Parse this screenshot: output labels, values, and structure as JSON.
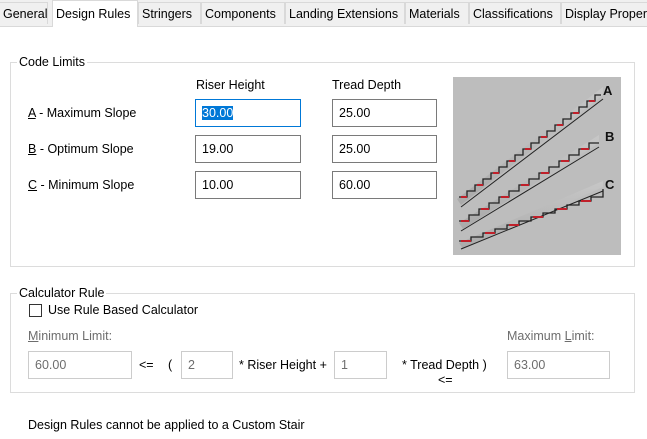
{
  "tabs": [
    {
      "label": "General",
      "active": false
    },
    {
      "label": "Design Rules",
      "active": true
    },
    {
      "label": "Stringers",
      "active": false
    },
    {
      "label": "Components",
      "active": false
    },
    {
      "label": "Landing Extensions",
      "active": false
    },
    {
      "label": "Materials",
      "active": false
    },
    {
      "label": "Classifications",
      "active": false
    },
    {
      "label": "Display Proper",
      "active": false
    }
  ],
  "code_limits": {
    "legend": "Code Limits",
    "col_riser": "Riser Height",
    "col_tread": "Tread Depth",
    "rows": [
      {
        "key": "A",
        "rest": " - Maximum Slope",
        "riser": "30.00",
        "tread": "25.00"
      },
      {
        "key": "B",
        "rest": " - Optimum Slope",
        "riser": "19.00",
        "tread": "25.00"
      },
      {
        "key": "C",
        "rest": " - Minimum Slope",
        "riser": "10.00",
        "tread": "60.00"
      }
    ],
    "diagram_labels": [
      "A",
      "B",
      "C"
    ]
  },
  "calculator": {
    "legend": "Calculator Rule",
    "checkbox_label": "Use Rule Based Calculator",
    "checked": false,
    "min_label_key": "M",
    "min_label_rest": "inimum Limit:",
    "max_label_pre": "Maximum ",
    "max_label_key": "L",
    "max_label_post": "imit:",
    "min_value": "60.00",
    "le1": "<=",
    "open_paren": "(",
    "riser_factor": "2",
    "riser_text": "* Riser Height +",
    "tread_factor": "1",
    "tread_text": "* Tread Depth )",
    "le2": "<=",
    "max_value": "63.00"
  },
  "footer_note": "Design Rules cannot be applied to a Custom Stair",
  "colors": {
    "focus": "#0078d7",
    "step_red": "#c0202a",
    "diagram_bg": "#bdbdbd"
  }
}
